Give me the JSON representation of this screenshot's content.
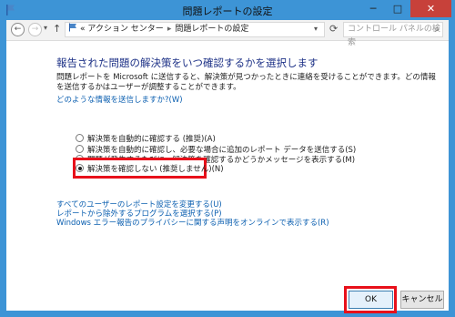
{
  "window": {
    "title": "問題レポートの設定",
    "controls": {
      "minimize": "─",
      "maximize": "□",
      "close": "✕"
    }
  },
  "navbar": {
    "back": "←",
    "forward": "→",
    "up": "↑",
    "breadcrumb": [
      "«",
      "アクション センター",
      "問題レポートの設定"
    ],
    "search_placeholder": "コントロール パネルの検索"
  },
  "main": {
    "heading": "報告された問題の解決策をいつ確認するかを選択します",
    "description": "問題レポートを Microsoft に送信すると、解決策が見つかったときに連絡を受けることができます。どの情報を送信するかはユーザーが調整することができます。",
    "info_link": "どのような情報を送信しますか?(W)",
    "options": [
      {
        "label": "解決策を自動的に確認する (推奨)(A)",
        "checked": false
      },
      {
        "label": "解決策を自動的に確認し、必要な場合に追加のレポート データを送信する(S)",
        "checked": false
      },
      {
        "label": "問題が発生するたびに、解決策を確認するかどうかメッセージを表示する(M)",
        "checked": false
      },
      {
        "label": "解決策を確認しない (推奨しません)(N)",
        "checked": true
      }
    ],
    "links": [
      "すべてのユーザーのレポート設定を変更する(U)",
      "レポートから除外するプログラムを選択する(P)",
      "Windows エラー報告のプライバシーに関する声明をオンラインで表示する(R)"
    ]
  },
  "footer": {
    "ok_label": "OK",
    "cancel_label": "キャンセル"
  },
  "colors": {
    "frame": "#3d94d6",
    "highlight": "#e8101a",
    "link": "#0b5fb0",
    "heading": "#1e3287"
  }
}
